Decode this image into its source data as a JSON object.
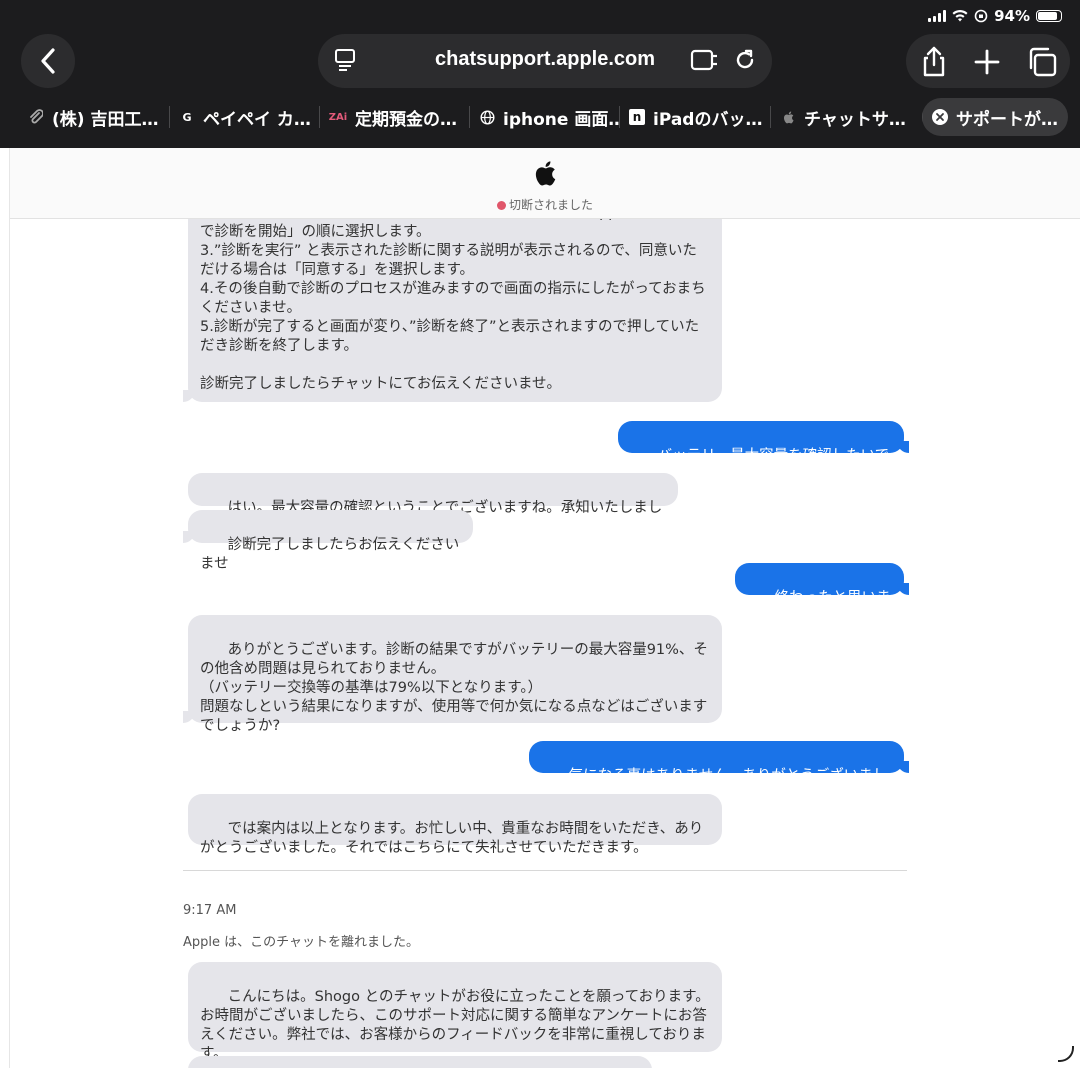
{
  "status": {
    "battery": "94%"
  },
  "browser": {
    "url": "chatsupport.apple.com",
    "tabs": [
      {
        "title": "(株) 吉田工…",
        "icon": "clip-icon",
        "active": false
      },
      {
        "title": "ペイペイ カ…",
        "icon": "google-g-icon",
        "active": false
      },
      {
        "title": "定期預金の…",
        "icon": "zai-icon",
        "active": false
      },
      {
        "title": "iphone 画面…",
        "icon": "globe-icon",
        "active": false
      },
      {
        "title": "iPadのバッ…",
        "icon": "n-icon",
        "active": false
      },
      {
        "title": "チャットサ…",
        "icon": "apple-icon",
        "active": false
      },
      {
        "title": "サポートが…",
        "icon": "close-icon",
        "active": true
      }
    ]
  },
  "chat": {
    "connection_status": "切断されました",
    "messages": [
      {
        "from": "agent",
        "text": "面をスクロールすると見つかりますので「診断と修理」→「Appleのサポートで診断を開始」の順に選択します。\n3.”診断を実行” と表示された診断に関する説明が表示されるので、同意いただける場合は「同意する」を選択します。\n4.その後自動で診断のプロセスが進みますので画面の指示にしたがっておまちくださいませ。\n5.診断が完了すると画面が変り、”診断を終了”と表示されますので押していただき診断を終了します。\n\n診断完了しましたらチャットにてお伝えくださいませ。"
      },
      {
        "from": "user",
        "text": "バッテリー最大容量を確認したいです。"
      },
      {
        "from": "agent",
        "text": "はい。最大容量の確認ということでございますね。承知いたしました。"
      },
      {
        "from": "agent",
        "text": "診断完了しましたらお伝えくださいませ"
      },
      {
        "from": "user",
        "text": "終わったと思います。"
      },
      {
        "from": "agent",
        "text": "ありがとうございます。診断の結果ですがバッテリーの最大容量91%、その他含め問題は見られておりません。\n（バッテリー交換等の基準は79%以下となります。）\n問題なしという結果になりますが、使用等で何か気になる点などはございますでしょうか?"
      },
      {
        "from": "user",
        "text": "気になる事はありません。ありがとうございました。"
      },
      {
        "from": "agent",
        "text": "では案内は以上となります。お忙しい中、貴重なお時間をいただき、ありがとうございました。それではこちらにて失礼させていただきます。"
      }
    ],
    "timestamp": "9:17 AM",
    "left_notice": "Apple は、このチャットを離れました。",
    "survey_message": "こんにちは。Shogo とのチャットがお役に立ったことを願っております。お時間がございましたら、このサポート対応に関する簡単なアンケートにお答えください。弊社では、お客様からのフィードバックを非常に重視しております。"
  }
}
